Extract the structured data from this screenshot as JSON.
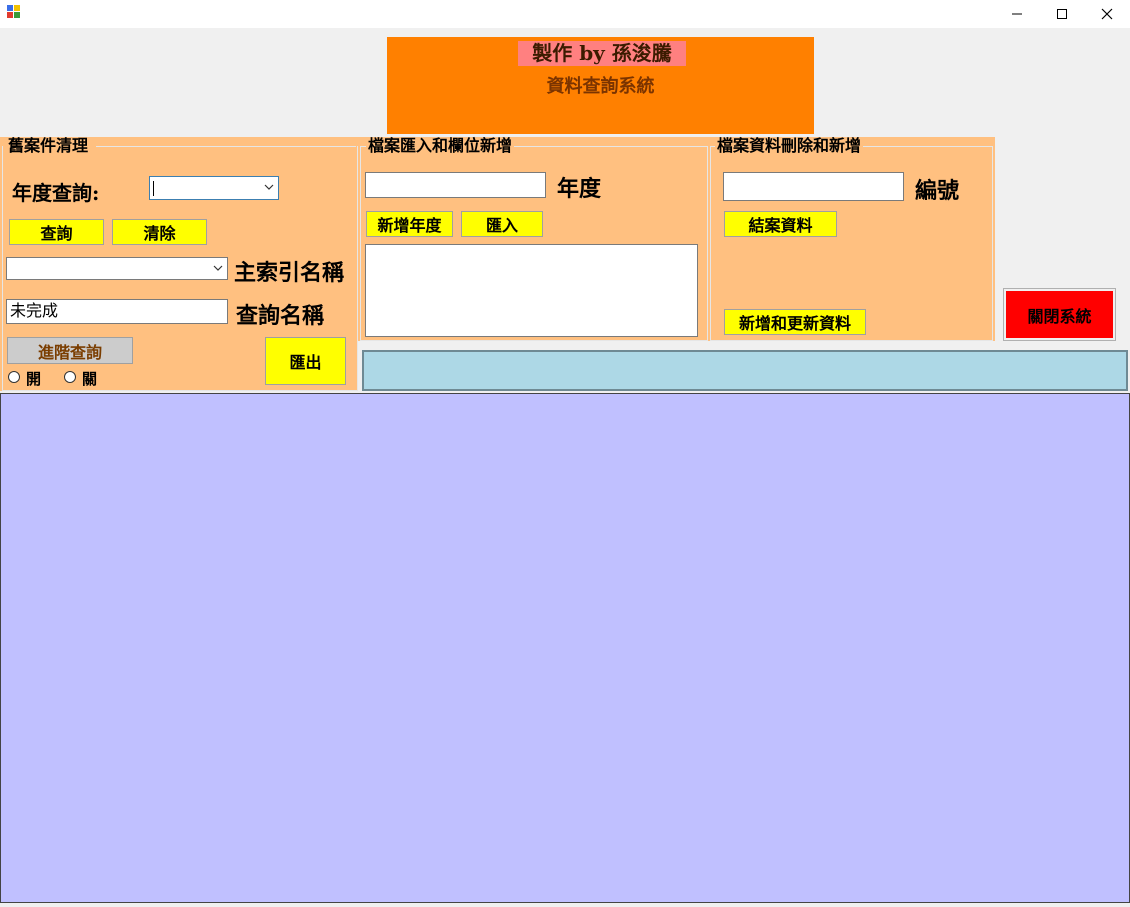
{
  "window": {
    "controls": [
      "minimize-icon",
      "maximize-icon",
      "close-icon"
    ]
  },
  "banner": {
    "credit": "製作 by 孫浚騰",
    "title": "資料查詢系統"
  },
  "cleanup": {
    "group_title": "舊案件清理",
    "year_label": "年度查詢:",
    "year_value": "",
    "query_button": "查詢",
    "clear_button": "清除",
    "index_label": "主索引名稱",
    "index_value": "",
    "name_value": "未完成",
    "name_label": "查詢名稱",
    "advanced_button": "進階查詢",
    "export_button": "匯出",
    "radio_on": "開",
    "radio_off": "關"
  },
  "import": {
    "group_title": "檔案匯入和欄位新增",
    "year_value": "",
    "year_label": "年度",
    "add_year_button": "新增年度",
    "import_button": "匯入",
    "textarea_value": ""
  },
  "records": {
    "group_title": "檔案資料刪除和新增",
    "id_value": "",
    "id_label": "編號",
    "close_case_button": "結案資料",
    "add_update_button": "新增和更新資料"
  },
  "exit_button": "關閉系統",
  "colors": {
    "banner": "#ff8000",
    "credit_bg": "#ff8080",
    "panel": "#ffc080",
    "button": "#ffff00",
    "exit": "#ff0000",
    "status_strip": "#add8e6",
    "grid": "#c0c0ff"
  }
}
